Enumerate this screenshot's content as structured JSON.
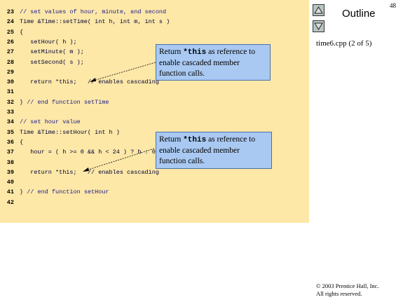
{
  "page_number": "48",
  "outline": {
    "title": "Outline",
    "up_icon": "triangle-up-icon",
    "down_icon": "triangle-down-icon"
  },
  "file_label": "time6.cpp (2 of 5)",
  "code_lines": [
    {
      "num": "23",
      "text": "// set values of hour, minute, and second"
    },
    {
      "num": "24",
      "text": "Time &Time::setTime( int h, int m, int s )"
    },
    {
      "num": "25",
      "text": "{"
    },
    {
      "num": "26",
      "text": "   setHour( h );"
    },
    {
      "num": "27",
      "text": "   setMinute( m );"
    },
    {
      "num": "28",
      "text": "   setSecond( s );"
    },
    {
      "num": "29",
      "text": ""
    },
    {
      "num": "30",
      "text": "   return *this;   // enables cascading"
    },
    {
      "num": "31",
      "text": ""
    },
    {
      "num": "32",
      "text": "} // end function setTime"
    },
    {
      "num": "33",
      "text": ""
    },
    {
      "num": "34",
      "text": "// set hour value"
    },
    {
      "num": "35",
      "text": "Time &Time::setHour( int h )"
    },
    {
      "num": "36",
      "text": "{"
    },
    {
      "num": "37",
      "text": "   hour = ( h >= 0 && h < 24 ) ? h : 0;"
    },
    {
      "num": "38",
      "text": ""
    },
    {
      "num": "39",
      "text": "   return *this;   // enables cascading"
    },
    {
      "num": "40",
      "text": ""
    },
    {
      "num": "41",
      "text": "} // end function setHour"
    },
    {
      "num": "42",
      "text": ""
    }
  ],
  "callouts": [
    {
      "pre": "Return ",
      "keyword": "*this",
      "post": " as reference to enable cascaded member function calls."
    },
    {
      "pre": "Return ",
      "keyword": "*this",
      "post": " as reference to enable cascaded member function calls."
    }
  ],
  "copyright": {
    "line1": "© 2003 Prentice Hall, Inc.",
    "line2": "All rights reserved."
  }
}
